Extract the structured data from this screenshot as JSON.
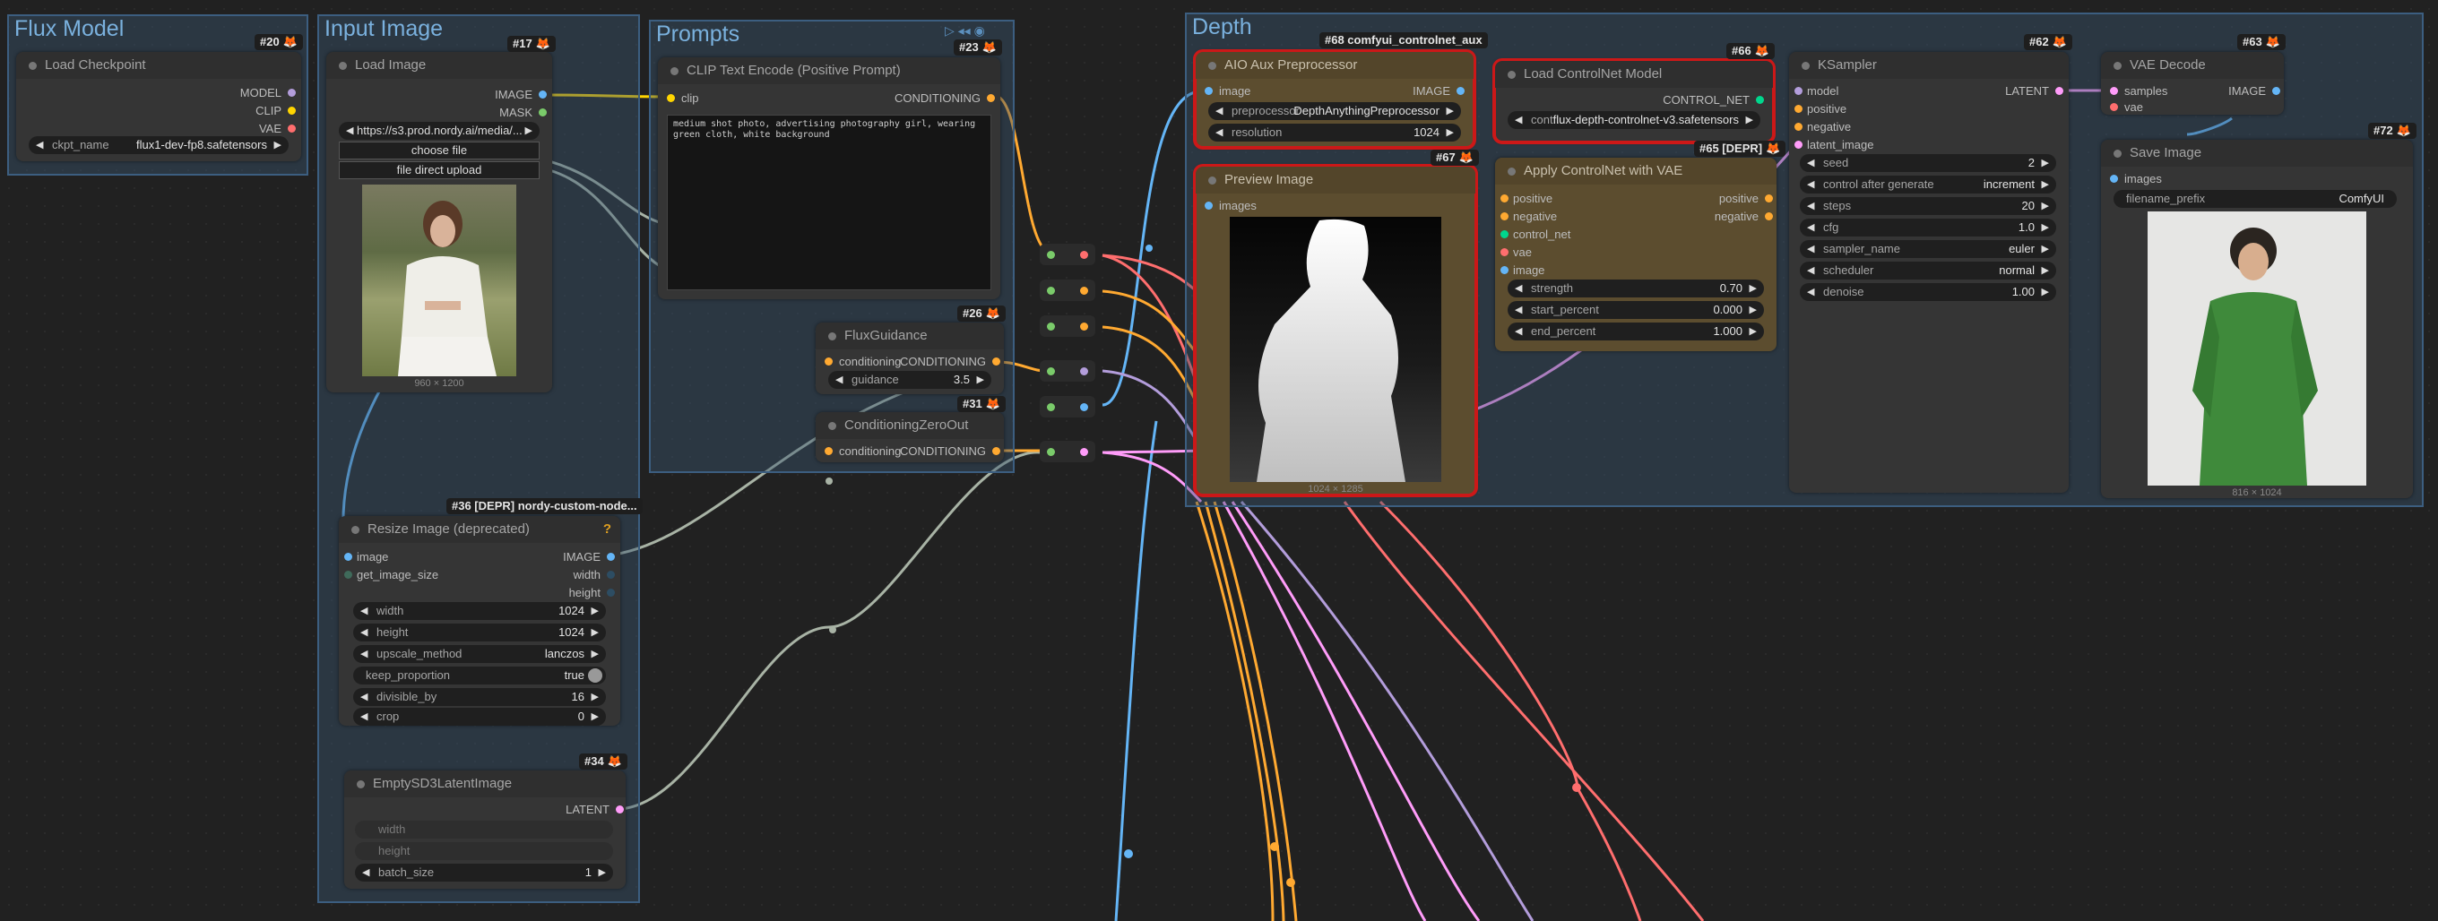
{
  "groups": {
    "flux_model": "Flux Model",
    "input_image": "Input Image",
    "prompts": "Prompts",
    "depth": "Depth"
  },
  "load_checkpoint": {
    "title": "Load Checkpoint",
    "badge": "#20",
    "outputs": [
      "MODEL",
      "CLIP",
      "VAE"
    ],
    "ckpt_label": "ckpt_name",
    "ckpt_value": "flux1-dev-fp8.safetensors"
  },
  "load_image": {
    "title": "Load Image",
    "badge": "#17",
    "outputs": [
      "IMAGE",
      "MASK"
    ],
    "url": "https://s3.prod.nordy.ai/media/...",
    "choose_file": "choose file",
    "direct_upload": "file direct upload",
    "caption": "960 × 1200"
  },
  "clip_encode": {
    "title": "CLIP Text Encode (Positive Prompt)",
    "badge": "#23",
    "input": "clip",
    "output": "CONDITIONING",
    "text": "medium shot photo, advertising photography girl, wearing green cloth, white background"
  },
  "flux_guidance": {
    "title": "FluxGuidance",
    "badge": "#26",
    "input": "conditioning",
    "output": "CONDITIONING",
    "guidance_label": "guidance",
    "guidance_value": "3.5"
  },
  "cond_zero": {
    "title": "ConditioningZeroOut",
    "badge": "#31",
    "input": "conditioning",
    "output": "CONDITIONING"
  },
  "resize": {
    "title": "Resize Image (deprecated)",
    "badge": "#36 [DEPR] nordy-custom-node...",
    "help": "?",
    "inputs": [
      "image",
      "get_image_size"
    ],
    "outputs": [
      "IMAGE",
      "width",
      "height"
    ],
    "widgets": [
      {
        "label": "width",
        "value": "1024"
      },
      {
        "label": "height",
        "value": "1024"
      },
      {
        "label": "upscale_method",
        "value": "lanczos"
      },
      {
        "label": "keep_proportion",
        "value": "true"
      },
      {
        "label": "divisible_by",
        "value": "16"
      },
      {
        "label": "crop",
        "value": "0"
      }
    ]
  },
  "empty_latent": {
    "title": "EmptySD3LatentImage",
    "badge": "#34",
    "output": "LATENT",
    "widgets": [
      {
        "label": "width",
        "value": ""
      },
      {
        "label": "height",
        "value": ""
      },
      {
        "label": "batch_size",
        "value": "1"
      }
    ]
  },
  "aio": {
    "title": "AIO Aux Preprocessor",
    "badge": "#68 comfyui_controlnet_aux",
    "input": "image",
    "output": "IMAGE",
    "pre_label": "preprocessor",
    "pre_value": "DepthAnythingPreprocessor",
    "res_label": "resolution",
    "res_value": "1024"
  },
  "preview": {
    "title": "Preview Image",
    "badge": "#67",
    "input": "images",
    "caption": "1024 × 1285"
  },
  "load_cn": {
    "title": "Load ControlNet Model",
    "badge": "#66",
    "output": "CONTROL_NET",
    "label": "cont...",
    "value": "flux-depth-controlnet-v3.safetensors"
  },
  "apply_cn": {
    "title": "Apply ControlNet with VAE",
    "badge": "#65 [DEPR]",
    "inputs": [
      "positive",
      "negative",
      "control_net",
      "vae",
      "image"
    ],
    "outputs": [
      "positive",
      "negative"
    ],
    "widgets": [
      {
        "label": "strength",
        "value": "0.70"
      },
      {
        "label": "start_percent",
        "value": "0.000"
      },
      {
        "label": "end_percent",
        "value": "1.000"
      }
    ]
  },
  "ksampler": {
    "title": "KSampler",
    "badge": "#62",
    "inputs": [
      "model",
      "positive",
      "negative",
      "latent_image"
    ],
    "output": "LATENT",
    "widgets": [
      {
        "label": "seed",
        "value": "2"
      },
      {
        "label": "control after generate",
        "value": "increment"
      },
      {
        "label": "steps",
        "value": "20"
      },
      {
        "label": "cfg",
        "value": "1.0"
      },
      {
        "label": "sampler_name",
        "value": "euler"
      },
      {
        "label": "scheduler",
        "value": "normal"
      },
      {
        "label": "denoise",
        "value": "1.00"
      }
    ]
  },
  "vae_decode": {
    "title": "VAE Decode",
    "badge": "#63",
    "inputs": [
      "samples",
      "vae"
    ],
    "output": "IMAGE"
  },
  "save_image": {
    "title": "Save Image",
    "badge": "#72",
    "input": "images",
    "prefix_label": "filename_prefix",
    "prefix_value": "ComfyUI",
    "caption": "816 × 1024"
  },
  "colors": {
    "model": "#b39ddb",
    "clip": "#ffd500",
    "vae": "#ff6e6e",
    "image": "#64b5f6",
    "conditioning": "#ffa931",
    "latent": "#ff9cf9",
    "control_net": "#00d78d",
    "group_fill": "#3a5670",
    "node_bg": "#353535",
    "brown": "#5c4d2f"
  }
}
